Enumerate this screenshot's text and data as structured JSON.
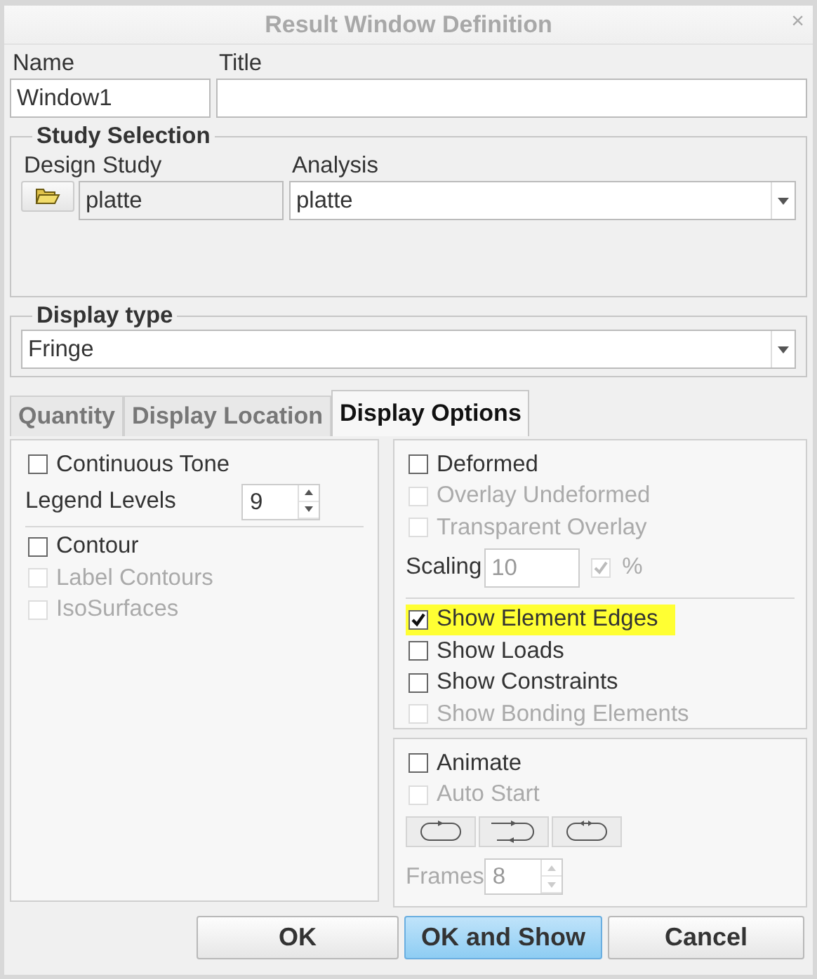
{
  "window": {
    "title": "Result Window Definition",
    "close": "×"
  },
  "name_field": {
    "label": "Name",
    "value": "Window1"
  },
  "title_field": {
    "label": "Title"
  },
  "study_selection": {
    "title": "Study Selection",
    "design_study": {
      "label": "Design Study",
      "value": "platte"
    },
    "analysis": {
      "label": "Analysis",
      "value": "platte"
    }
  },
  "display_type": {
    "title": "Display type",
    "value": "Fringe"
  },
  "tabs": [
    {
      "label": "Quantity",
      "selected": false
    },
    {
      "label": "Display Location",
      "selected": false
    },
    {
      "label": "Display Options",
      "selected": true
    }
  ],
  "left_panel": {
    "options": [
      {
        "kind": "checkbox",
        "label": "Continuous Tone",
        "checked": false,
        "disabled": false
      },
      {
        "kind": "spinner",
        "label": "Legend Levels",
        "value": "9",
        "disabled": false
      },
      {
        "kind": "divider"
      },
      {
        "kind": "checkbox",
        "label": "Contour",
        "checked": false,
        "disabled": false
      },
      {
        "kind": "checkbox",
        "label": "Label Contours",
        "checked": false,
        "disabled": true
      },
      {
        "kind": "checkbox",
        "label": "IsoSurfaces",
        "checked": false,
        "disabled": true
      }
    ]
  },
  "right_panel": {
    "options": [
      {
        "kind": "checkbox",
        "label": "Deformed",
        "checked": false,
        "disabled": false
      },
      {
        "kind": "checkbox",
        "label": "Overlay Undeformed",
        "checked": false,
        "disabled": true
      },
      {
        "kind": "checkbox",
        "label": "Transparent Overlay",
        "checked": false,
        "disabled": true
      },
      {
        "kind": "scaling",
        "label": "Scaling",
        "value": "10",
        "unit": "%",
        "checked": true,
        "disabled": true
      },
      {
        "kind": "divider"
      },
      {
        "kind": "checkbox",
        "label": "Show Element Edges",
        "checked": true,
        "disabled": false,
        "highlighted": true
      },
      {
        "kind": "checkbox",
        "label": "Show Loads",
        "checked": false,
        "disabled": false
      },
      {
        "kind": "checkbox",
        "label": "Show Constraints",
        "checked": false,
        "disabled": false
      },
      {
        "kind": "checkbox",
        "label": "Show Bonding Elements",
        "checked": false,
        "disabled": true
      }
    ]
  },
  "animation_panel": {
    "options": [
      {
        "kind": "checkbox",
        "label": "Animate",
        "checked": false,
        "disabled": false
      },
      {
        "kind": "checkbox",
        "label": "Auto Start",
        "checked": false,
        "disabled": true
      },
      {
        "kind": "loop_buttons"
      },
      {
        "kind": "spinner",
        "label": "Frames",
        "value": "8",
        "disabled": true
      }
    ]
  },
  "buttons": [
    {
      "label": "OK",
      "focused": false
    },
    {
      "label": "OK and Show",
      "focused": true
    },
    {
      "label": "Cancel",
      "focused": false
    }
  ]
}
